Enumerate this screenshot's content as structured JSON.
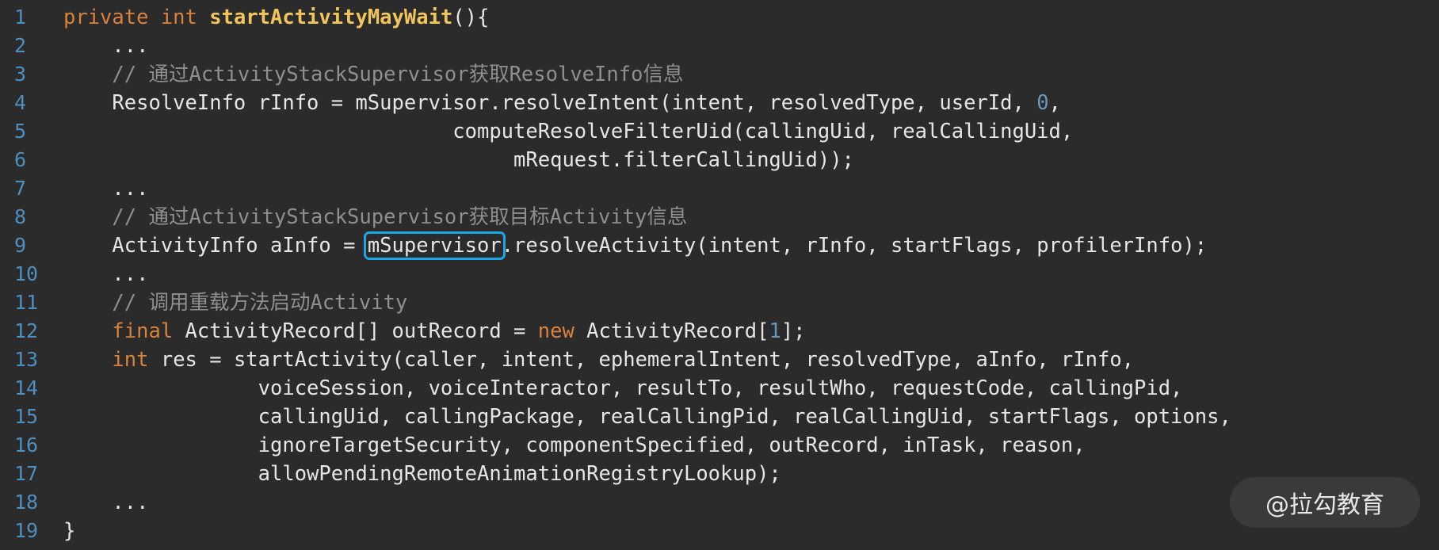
{
  "line_numbers": [
    "1",
    "2",
    "3",
    "4",
    "5",
    "6",
    "7",
    "8",
    "9",
    "10",
    "11",
    "12",
    "13",
    "14",
    "15",
    "16",
    "17",
    "18",
    "19"
  ],
  "code": {
    "l1": {
      "kw1": "private",
      "sp1": " ",
      "kw2": "int",
      "sp2": " ",
      "fn": "startActivityMayWait",
      "rest": "(){"
    },
    "l2": {
      "text": "    ..."
    },
    "l3": {
      "text": "    // 通过ActivityStackSupervisor获取ResolveInfo信息"
    },
    "l4": {
      "pre": "    ResolveInfo rInfo = mSupervisor.resolveIntent(intent, resolvedType, userId, ",
      "num": "0",
      "post": ","
    },
    "l5": {
      "text": "                                computeResolveFilterUid(callingUid, realCallingUid,"
    },
    "l6": {
      "text": "                                     mRequest.filterCallingUid));"
    },
    "l7": {
      "text": "    ..."
    },
    "l8": {
      "text": "    // 通过ActivityStackSupervisor获取目标Activity信息"
    },
    "l9": {
      "pre": "    ActivityInfo aInfo = ",
      "highlight": "mSupervisor",
      "post": ".resolveActivity(intent, rInfo, startFlags, profilerInfo);"
    },
    "l10": {
      "text": "    ..."
    },
    "l11": {
      "text": "    // 调用重载方法启动Activity"
    },
    "l12": {
      "indent": "    ",
      "kw1": "final",
      "mid": " ActivityRecord[] outRecord = ",
      "kw2": "new",
      "mid2": " ActivityRecord[",
      "num": "1",
      "post": "];"
    },
    "l13": {
      "indent": "    ",
      "kw": "int",
      "post": " res = startActivity(caller, intent, ephemeralIntent, resolvedType, aInfo, rInfo,"
    },
    "l14": {
      "text": "                voiceSession, voiceInteractor, resultTo, resultWho, requestCode, callingPid,"
    },
    "l15": {
      "text": "                callingUid, callingPackage, realCallingPid, realCallingUid, startFlags, options,"
    },
    "l16": {
      "text": "                ignoreTargetSecurity, componentSpecified, outRecord, inTask, reason,"
    },
    "l17": {
      "text": "                allowPendingRemoteAnimationRegistryLookup);"
    },
    "l18": {
      "text": "    ..."
    },
    "l19": {
      "text": "}"
    }
  },
  "watermark": "@拉勾教育",
  "colors": {
    "background": "#2b2b2b",
    "line_number": "#4e8fbf",
    "keyword": "#d9823b",
    "function": "#f2c55c",
    "number": "#6897bb",
    "comment": "#8f8f8f",
    "highlight_border": "#1ea7e6"
  }
}
